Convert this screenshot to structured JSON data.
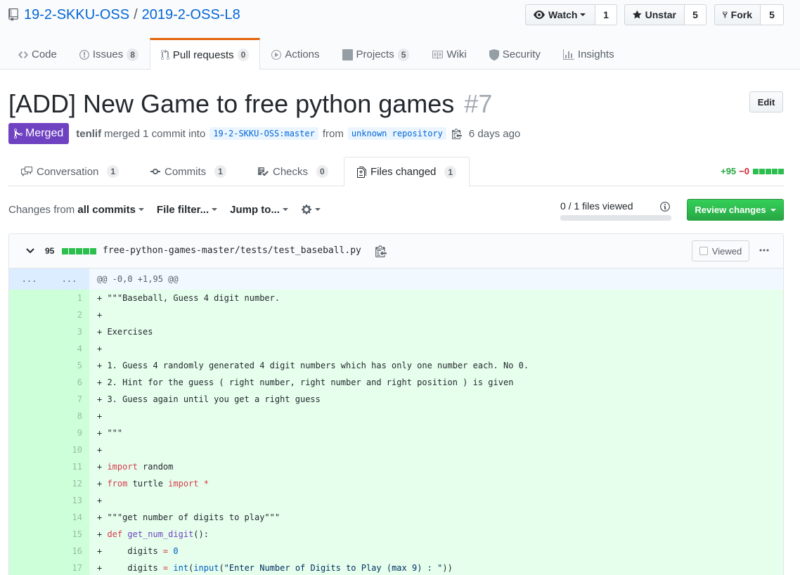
{
  "repo": {
    "owner": "19-2-SKKU-OSS",
    "separator": "/",
    "name": "2019-2-OSS-L8"
  },
  "social": {
    "watch_label": "Watch",
    "watch_count": "1",
    "star_label": "Unstar",
    "star_count": "5",
    "fork_label": "Fork",
    "fork_count": "5"
  },
  "nav": {
    "code": "Code",
    "issues": "Issues",
    "issues_count": "8",
    "pulls": "Pull requests",
    "pulls_count": "0",
    "actions": "Actions",
    "projects": "Projects",
    "projects_count": "5",
    "wiki": "Wiki",
    "security": "Security",
    "insights": "Insights"
  },
  "pr": {
    "title": "[ADD] New Game to free python games",
    "number": "#7",
    "edit_label": "Edit",
    "state": "Merged",
    "author": "tenlif",
    "merged_text": "merged 1 commit into",
    "base_branch": "19-2-SKKU-OSS:master",
    "from_text": "from",
    "head_branch": "unknown repository",
    "time": "6 days ago"
  },
  "tabs": {
    "conversation": "Conversation",
    "conversation_count": "1",
    "commits": "Commits",
    "commits_count": "1",
    "checks": "Checks",
    "checks_count": "0",
    "files": "Files changed",
    "files_count": "1"
  },
  "diffstat": {
    "additions": "+95",
    "deletions": "−0"
  },
  "toolbar": {
    "changes_from": "Changes from",
    "all_commits": "all commits",
    "file_filter": "File filter...",
    "jump_to": "Jump to...",
    "files_viewed": "0 / 1 files viewed",
    "files_viewed_fraction": 0,
    "review_button": "Review changes"
  },
  "file": {
    "lines_changed": "95",
    "path": "free-python-games-master/tests/test_baseball.py",
    "viewed_label": "Viewed",
    "hunk_left": "...",
    "hunk_right": "...",
    "hunk_header": "@@ -0,0 +1,95 @@",
    "lines": [
      {
        "num": "1",
        "code": "+ \"\"\"Baseball, Guess 4 digit number."
      },
      {
        "num": "2",
        "code": "+"
      },
      {
        "num": "3",
        "code": "+ Exercises"
      },
      {
        "num": "4",
        "code": "+"
      },
      {
        "num": "5",
        "code": "+ 1. Guess 4 randomly generated 4 digit numbers which has only one number each. No 0."
      },
      {
        "num": "6",
        "code": "+ 2. Hint for the guess ( right number, right number and right position ) is given"
      },
      {
        "num": "7",
        "code": "+ 3. Guess again until you get a right guess"
      },
      {
        "num": "8",
        "code": "+"
      },
      {
        "num": "9",
        "code": "+ \"\"\""
      },
      {
        "num": "10",
        "code": "+"
      },
      {
        "num": "11",
        "code": "+ import random"
      },
      {
        "num": "12",
        "code": "+ from turtle import *"
      },
      {
        "num": "13",
        "code": "+"
      },
      {
        "num": "14",
        "code": "+ \"\"\"get number of digits to play\"\"\""
      },
      {
        "num": "15",
        "code": "+ def get_num_digit():"
      },
      {
        "num": "16",
        "code": "+     digits = 0"
      },
      {
        "num": "17",
        "code": "+     digits = int(input(\"Enter Number of Digits to Play (max 9) : \"))"
      }
    ]
  }
}
